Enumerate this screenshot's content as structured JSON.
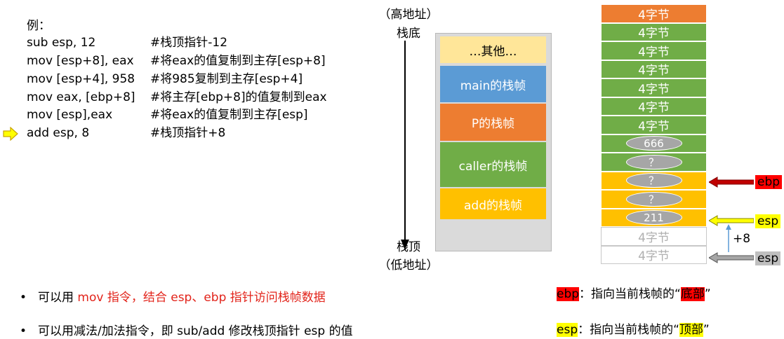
{
  "code": {
    "title": "例：",
    "lines": [
      {
        "ins": "sub esp, 12",
        "cmt": "#栈顶指针-12"
      },
      {
        "ins": "mov [esp+8], eax",
        "cmt": "#将eax的值复制到主存[esp+8]"
      },
      {
        "ins": "mov [esp+4], 958",
        "cmt": "#将985复制到主存[esp+4]"
      },
      {
        "ins": "mov eax, [ebp+8]",
        "cmt": "#将主存[ebp+8]的值复制到eax"
      },
      {
        "ins": "mov [esp],eax",
        "cmt": " #将eax的值复制到主存[esp]"
      },
      {
        "ins": "add esp, 8",
        "cmt": "#栈顶指针+8"
      }
    ]
  },
  "stack": {
    "high_addr": "（高地址）",
    "bottom": "栈底",
    "top": "栈顶",
    "low_addr": "（低地址）",
    "frames": [
      {
        "label": "…其他…",
        "color": "#ffe699",
        "text_color": "#000000"
      },
      {
        "label": "main的栈帧",
        "color": "#5b9bd5",
        "text_color": "#ffffff"
      },
      {
        "label": "P的栈帧",
        "color": "#ed7d31",
        "text_color": "#ffffff"
      },
      {
        "label": "caller的栈帧",
        "color": "#70ad47",
        "text_color": "#ffffff"
      },
      {
        "label": "add的栈帧",
        "color": "#ffc000",
        "text_color": "#ffffff"
      }
    ]
  },
  "bytes": {
    "cells": [
      {
        "kind": "orange",
        "label": "4字节"
      },
      {
        "kind": "green",
        "label": "4字节"
      },
      {
        "kind": "green",
        "label": "4字节"
      },
      {
        "kind": "green",
        "label": "4字节"
      },
      {
        "kind": "green",
        "label": "4字节"
      },
      {
        "kind": "green",
        "label": "4字节"
      },
      {
        "kind": "green",
        "label": "4字节"
      },
      {
        "kind": "green",
        "oval": "666"
      },
      {
        "kind": "green",
        "oval": "？"
      },
      {
        "kind": "yellow",
        "oval": "？"
      },
      {
        "kind": "yellow",
        "oval": "？"
      },
      {
        "kind": "yellow",
        "oval": "211"
      },
      {
        "kind": "white",
        "label": "4字节"
      },
      {
        "kind": "white",
        "label": "4字节"
      }
    ],
    "ebp_label": "ebp",
    "esp_label": "esp",
    "old_esp_label": "esp",
    "offset_label": "+8"
  },
  "bullets": [
    {
      "pre": "可以用 ",
      "red": "mov 指令，结合 esp、ebp 指针访问栈帧数据",
      "post": ""
    },
    {
      "pre": "可以用减法/加法指令，即 sub/add 修改栈顶指针 esp 的值",
      "red": "",
      "post": ""
    }
  ],
  "legend": {
    "ebp_tag": "ebp",
    "ebp_text": "：指向当前栈帧的“",
    "ebp_highlight": "底部",
    "ebp_close": "”",
    "esp_tag": "esp",
    "esp_text": "：指向当前栈帧的“",
    "esp_highlight": "顶部",
    "esp_close": "”",
    "colors": {
      "ebp": "#ff0000",
      "esp": "#ffff00"
    }
  }
}
